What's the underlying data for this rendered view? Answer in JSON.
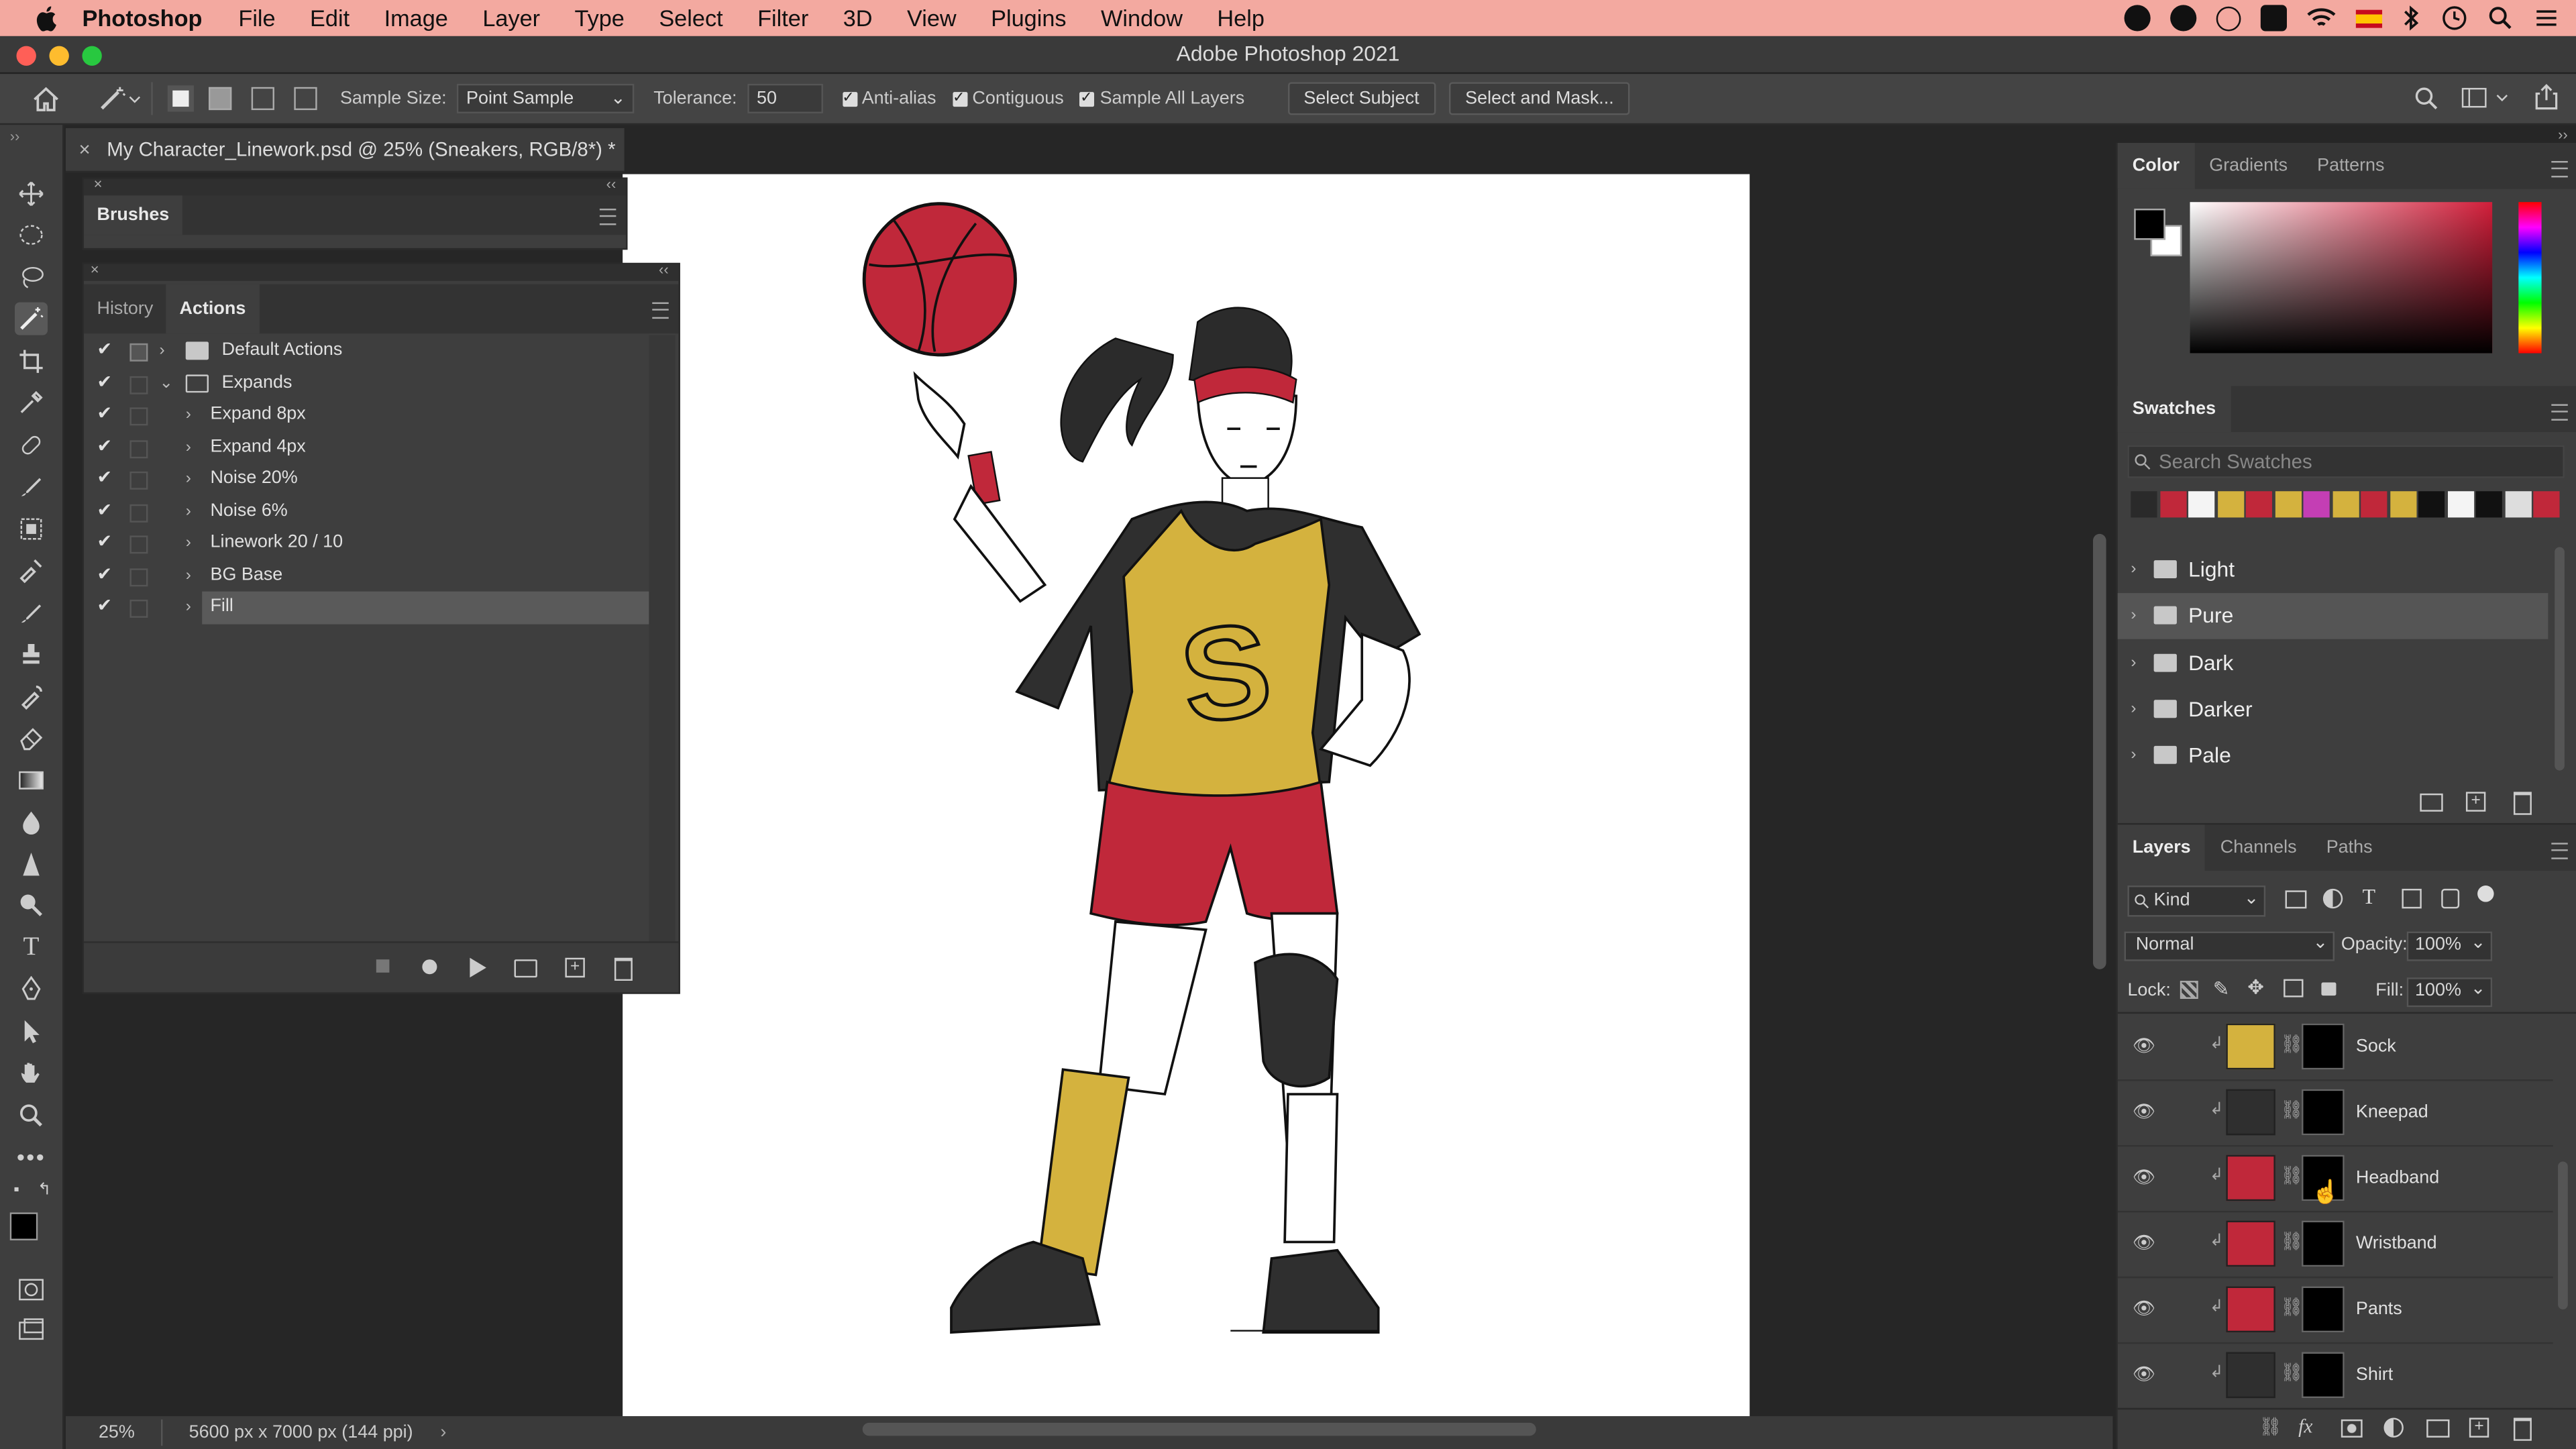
{
  "menubar": {
    "app": "Photoshop",
    "items": [
      "File",
      "Edit",
      "Image",
      "Layer",
      "Type",
      "Select",
      "Filter",
      "3D",
      "View",
      "Plugins",
      "Window",
      "Help"
    ]
  },
  "window": {
    "title": "Adobe Photoshop 2021"
  },
  "options": {
    "sample_size_label": "Sample Size:",
    "sample_size_value": "Point Sample",
    "tolerance_label": "Tolerance:",
    "tolerance_value": "50",
    "anti_alias": "Anti-alias",
    "contiguous": "Contiguous",
    "sample_all_layers": "Sample All Layers",
    "select_subject": "Select Subject",
    "select_and_mask": "Select and Mask..."
  },
  "document": {
    "tab_title": "My Character_Linework.psd @ 25% (Sneakers, RGB/8*) *"
  },
  "brushes_panel": {
    "title": "Brushes"
  },
  "actions_panel": {
    "tabs": [
      "History",
      "Actions"
    ],
    "rows": [
      {
        "label": "Default Actions",
        "kind": "set"
      },
      {
        "label": "Expands",
        "kind": "set-open"
      },
      {
        "label": "Expand 8px",
        "kind": "action"
      },
      {
        "label": "Expand 4px",
        "kind": "action"
      },
      {
        "label": "Noise 20%",
        "kind": "action"
      },
      {
        "label": "Noise 6%",
        "kind": "action"
      },
      {
        "label": "Linework 20 / 10",
        "kind": "action"
      },
      {
        "label": "BG Base",
        "kind": "action"
      },
      {
        "label": "Fill",
        "kind": "action"
      }
    ]
  },
  "color_panel": {
    "tabs": [
      "Color",
      "Gradients",
      "Patterns"
    ]
  },
  "swatches_panel": {
    "title": "Swatches",
    "search_placeholder": "Search Swatches",
    "colors": [
      "#2a2a2a",
      "#c0283a",
      "#f4f4f4",
      "#d4b23e",
      "#c0283a",
      "#d4b23e",
      "#c43eb4",
      "#d4b23e",
      "#c0283a",
      "#d4b23e",
      "#111111",
      "#f4f4f4",
      "#111111",
      "#dddddd",
      "#c0283a"
    ],
    "folders": [
      "Light",
      "Pure",
      "Dark",
      "Darker",
      "Pale"
    ]
  },
  "layers_panel": {
    "tabs": [
      "Layers",
      "Channels",
      "Paths"
    ],
    "filter_kind": "Kind",
    "blend_mode": "Normal",
    "opacity_label": "Opacity:",
    "opacity_value": "100%",
    "lock_label": "Lock:",
    "fill_label": "Fill:",
    "fill_value": "100%",
    "layers": [
      {
        "name": "Sock",
        "color": "#d4b23e"
      },
      {
        "name": "Kneepad",
        "color": "#2f2f2f"
      },
      {
        "name": "Headband",
        "color": "#c0283a"
      },
      {
        "name": "Wristband",
        "color": "#c0283a"
      },
      {
        "name": "Pants",
        "color": "#c0283a"
      },
      {
        "name": "Shirt",
        "color": "#2f2f2f"
      }
    ]
  },
  "status": {
    "zoom": "25%",
    "doc_size": "5600 px x 7000 px (144 ppi)"
  }
}
